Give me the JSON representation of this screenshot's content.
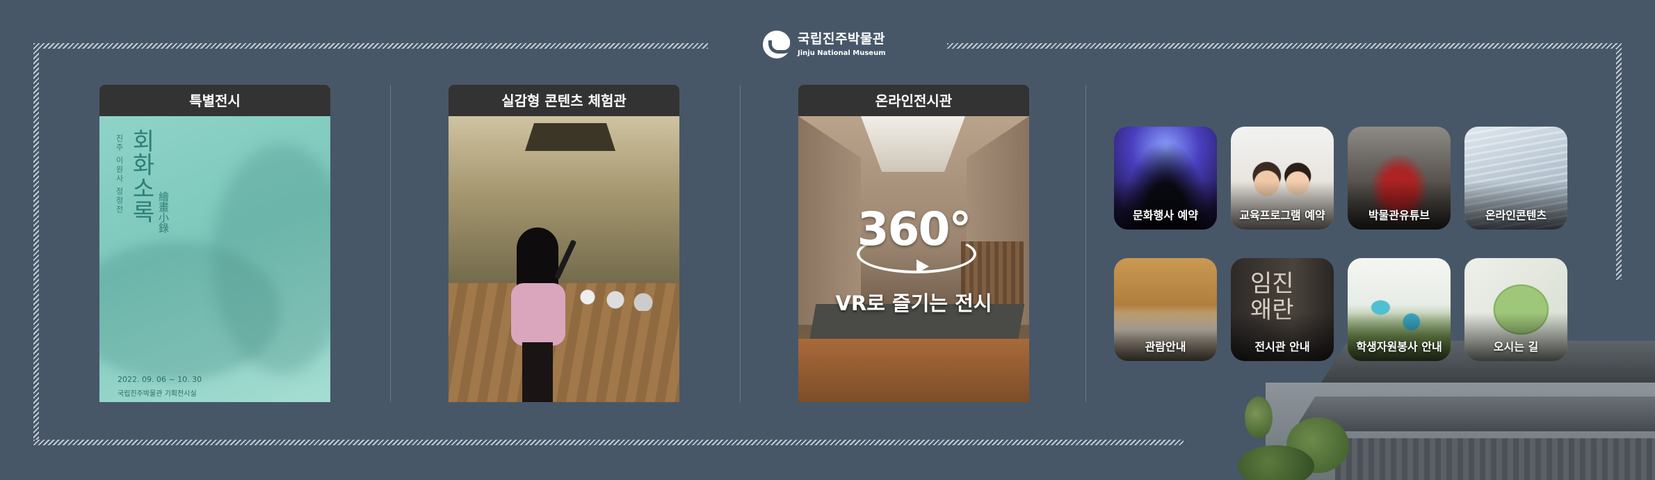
{
  "logo": {
    "name_ko": "국립진주박물관",
    "name_en": "Jinju National Museum"
  },
  "cards": [
    {
      "title": "특별전시",
      "poster": {
        "series": "진주 이원사 정정전",
        "title": "회화소록",
        "hanja": "繪畫小錄",
        "date": "2022. 09. 06 ~ 10. 30",
        "venue": "국립진주박물관 기획전시실"
      }
    },
    {
      "title": "실감형 콘텐츠 체험관"
    },
    {
      "title": "온라인전시관",
      "badge": "360°",
      "caption": "VR로 즐기는 전시"
    }
  ],
  "quick_links": [
    {
      "label": "문화행사 예약"
    },
    {
      "label": "교육프로그램 예약"
    },
    {
      "label": "박물관유튜브"
    },
    {
      "label": "온라인콘텐츠"
    },
    {
      "label": "관람안내"
    },
    {
      "label": "전시관 안내"
    },
    {
      "label": "학생자원봉사 안내"
    },
    {
      "label": "오시는 길"
    }
  ],
  "colors": {
    "background": "#475768",
    "card_header": "#333333",
    "hatch": "#c3ccd6"
  }
}
